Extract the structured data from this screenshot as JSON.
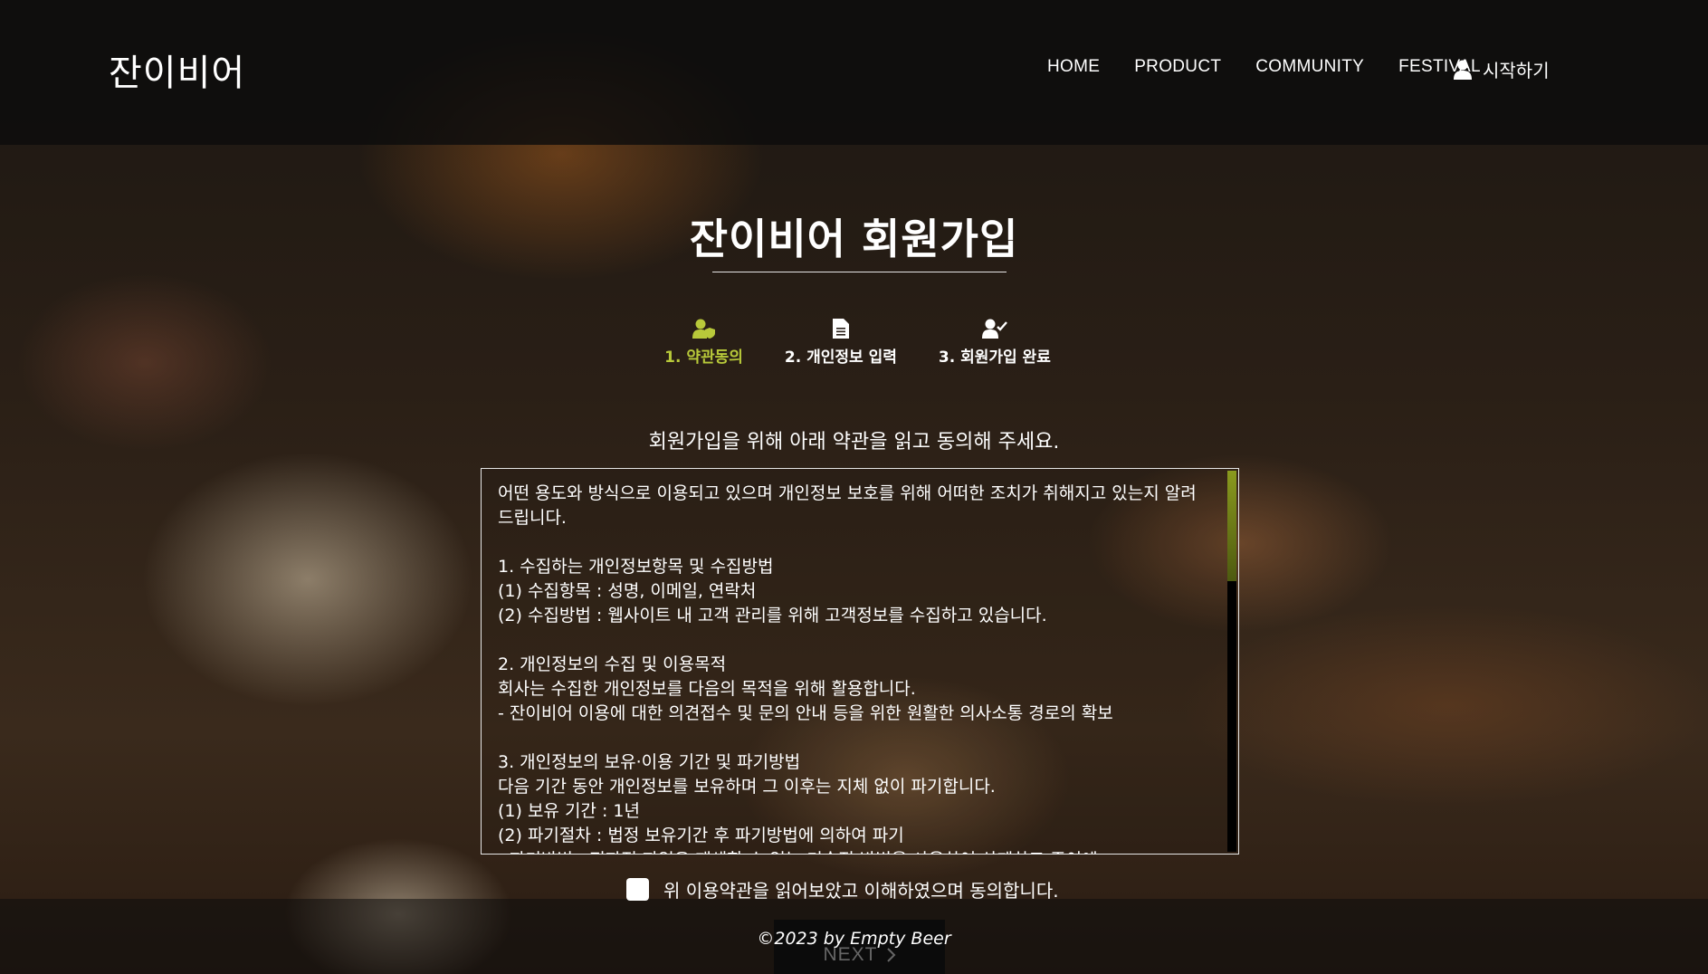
{
  "header": {
    "logo": "잔이비어",
    "nav": [
      "HOME",
      "PRODUCT",
      "COMMUNITY",
      "FESTIVAL"
    ],
    "start_label": "시작하기"
  },
  "page": {
    "title": "잔이비어 회원가입",
    "steps": [
      {
        "label": "1. 약관동의",
        "icon": "user-shield-icon",
        "active": true
      },
      {
        "label": "2. 개인정보 입력",
        "icon": "document-icon",
        "active": false
      },
      {
        "label": "3. 회원가입 완료",
        "icon": "user-check-icon",
        "active": false
      }
    ],
    "intro": "회원가입을 위해 아래 약관을 읽고 동의해 주세요.",
    "terms": "어떤 용도와 방식으로 이용되고 있으며 개인정보 보호를 위해 어떠한 조치가 취해지고 있는지 알려 드립니다.\n\n1. 수집하는 개인정보항목 및 수집방법\n(1) 수집항목 : 성명, 이메일, 연락처\n(2) 수집방법 : 웹사이트 내 고객 관리를 위해 고객정보를 수집하고 있습니다.\n\n2. 개인정보의 수집 및 이용목적\n회사는 수집한 개인정보를 다음의 목적을 위해 활용합니다.\n- 잔이비어 이용에 대한 의견접수 및 문의 안내 등을 위한 원활한 의사소통 경로의 확보\n\n3. 개인정보의 보유·이용 기간 및 파기방법\n다음 기간 동안 개인정보를 보유하며 그 이후는 지체 없이 파기합니다.\n(1) 보유 기간 : 1년\n(2) 파기절차 : 법정 보유기간 후 파기방법에 의하여 파기\n- 파기방법 : 전자적 파일은 재생할 수 없는 기술적 방법을 사용하여 삭제하고 종이에",
    "agree_label": "위 이용약관을 읽어보았고 이해하였으며 동의합니다.",
    "next_label": "NEXT",
    "scroll_fraction": 0.29
  },
  "footer": {
    "copyright": "©2023 by Empty Beer"
  },
  "colors": {
    "accent": "#b8c93a"
  }
}
